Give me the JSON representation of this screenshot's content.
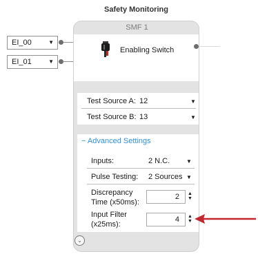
{
  "window_title": "Safety Monitoring",
  "inputs": [
    {
      "label": "EI_00"
    },
    {
      "label": "EI_01"
    }
  ],
  "block": {
    "header": "SMF 1",
    "function_label": "Enabling Switch",
    "test_source_a": {
      "label": "Test Source A:",
      "value": "12"
    },
    "test_source_b": {
      "label": "Test Source B:",
      "value": "13"
    },
    "advanced_toggle": "Advanced Settings",
    "advanced_toggle_symbol": "−",
    "inputs_setting": {
      "label": "Inputs:",
      "value": "2 N.C."
    },
    "pulse_testing": {
      "label": "Pulse Testing:",
      "value": "2 Sources"
    },
    "discrepancy_time": {
      "label_line1": "Discrepancy",
      "label_line2": "Time (x50ms):",
      "value": "2"
    },
    "input_filter": {
      "label_line1": "Input Filter",
      "label_line2": "(x25ms):",
      "value": "4"
    }
  },
  "colors": {
    "accent_link": "#2f8fd6",
    "annotation_arrow": "#c0282e"
  },
  "icons": {
    "dropdown": "caret-down-icon",
    "spinner": "spinner-arrows-icon",
    "expand": "chevron-down-circle-icon",
    "switch": "enabling-switch-icon"
  }
}
